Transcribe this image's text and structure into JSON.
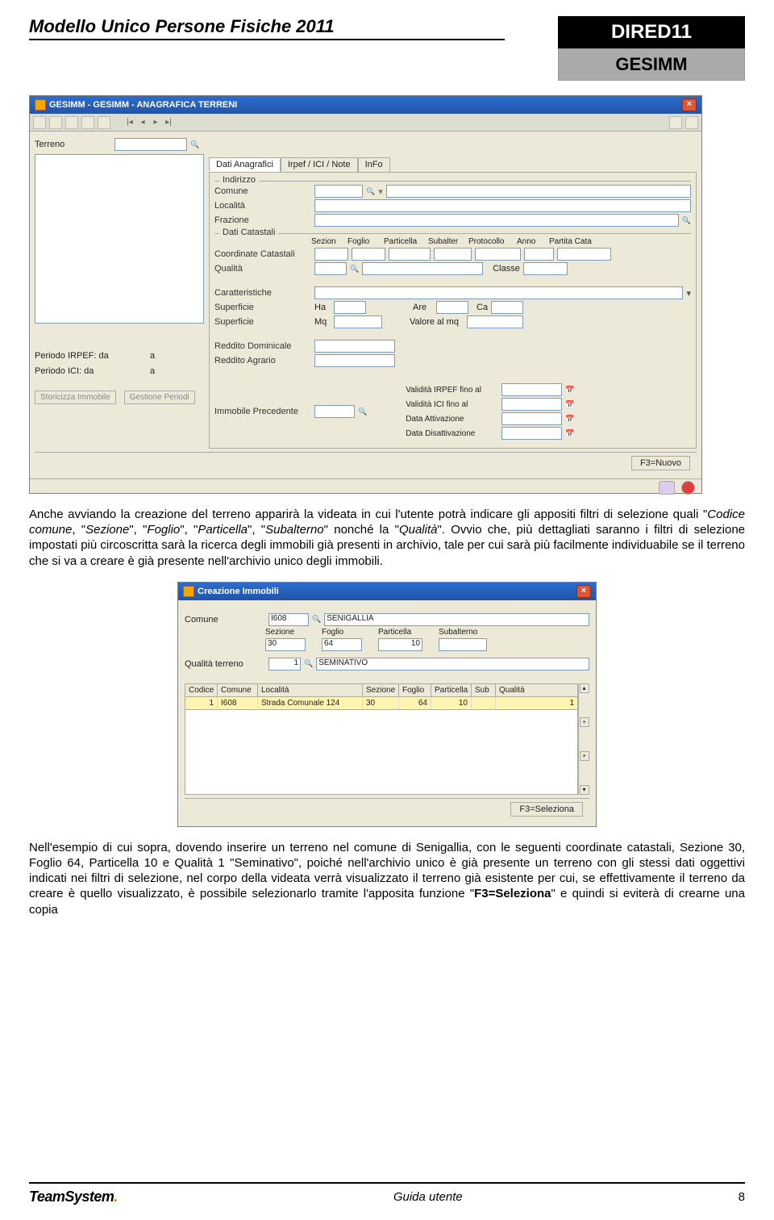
{
  "header": {
    "title": "Modello Unico Persone Fisiche 2011",
    "codebox": "DIRED11",
    "namebox": "GESIMM"
  },
  "win1": {
    "title": "GESIMM - GESIMM - ANAGRAFICA TERRENI",
    "terreno_label": "Terreno",
    "tabs": {
      "t1": "Dati Anagrafici",
      "t2": "Irpef / ICI / Note",
      "t3": "InFo"
    },
    "group1_label": "Indirizzo",
    "comune_label": "Comune",
    "localita_label": "Località",
    "frazione_label": "Frazione",
    "group2_label": "Dati Catastali",
    "cc_label": "Coordinate Catastali",
    "qualita_label": "Qualità",
    "classe_label": "Classe",
    "cols": {
      "sezion": "Sezion",
      "foglio": "Foglio",
      "particella": "Particella",
      "subalter": "Subalter",
      "protocollo": "Protocollo",
      "anno": "Anno",
      "partita": "Partita Cata"
    },
    "carat_label": "Caratteristiche",
    "sup1_label": "Superficie",
    "ha": "Ha",
    "are": "Are",
    "ca": "Ca",
    "sup2_label": "Superficie",
    "mq": "Mq",
    "valmq": "Valore al mq",
    "rd_label": "Reddito Dominicale",
    "ra_label": "Reddito Agrario",
    "pirpef": "Periodo IRPEF: da",
    "pici": "Periodo ICI: da",
    "a": "a",
    "stor": "Storicizza Immobile",
    "gest": "Gestione Periodi",
    "immprec": "Immobile Precedente",
    "valirpef": "Validità IRPEF fino al",
    "valici": "Validità ICI fino al",
    "dattiv": "Data Attivazione",
    "ddisatt": "Data Disattivazione",
    "f3": "F3=Nuovo"
  },
  "para1": {
    "p": "Anche avviando la creazione del terreno apparirà la videata in cui l'utente potrà indicare gli appositi filtri di selezione quali ",
    "i1": "Codice comune",
    "c1": ", \"",
    "i2": "Sezione",
    "c2": "\", \"",
    "i3": "Foglio",
    "c3": "\", \"",
    "i4": "Particella",
    "c4": "\", \"",
    "i5": "Subalterno",
    "c5": "\" nonché la \"",
    "i6": "Qualità",
    "c6": "\". Ovvio che, più dettagliati saranno i filtri di selezione impostati più circoscritta sarà la ricerca degli immobili già presenti in archivio, tale per cui sarà più facilmente individuabile se il terreno che si va a creare è già presente nell'archivio unico degli immobili."
  },
  "win2": {
    "title": "Creazione Immobili",
    "comune_label": "Comune",
    "comune_code": "I608",
    "comune_name": "SENIGALLIA",
    "sez_label": "Sezione",
    "fog_label": "Foglio",
    "part_label": "Particella",
    "sub_label": "Subalterno",
    "sez_v": "30",
    "fog_v": "64",
    "part_v": "10",
    "qt_label": "Qualità terreno",
    "qt_code": "1",
    "qt_name": "SEMINATIVO",
    "hdr": {
      "codice": "Codice",
      "comune": "Comune",
      "localita": "Località",
      "sezione": "Sezione",
      "foglio": "Foglio",
      "particella": "Particella",
      "sub": "Sub",
      "qualita": "Qualità"
    },
    "row": {
      "codice": "1",
      "comune": "I608",
      "localita": "Strada Comunale 124",
      "sezione": "30",
      "foglio": "64",
      "particella": "10",
      "sub": "",
      "qualita": "1"
    },
    "f3": "F3=Seleziona"
  },
  "para2": {
    "p": "Nell'esempio di cui sopra, dovendo inserire un terreno nel comune di Senigallia, con le seguenti coordinate catastali, Sezione 30, Foglio 64, Particella 10 e Qualità 1 \"Seminativo\", poiché nell'archivio unico è già presente un terreno con gli stessi dati oggettivi indicati nei filtri di selezione, nel corpo della videata verrà visualizzato il terreno già esistente per cui, se effettivamente il terreno da creare è quello visualizzato, è possibile selezionarlo tramite l'apposita funzione \"",
    "b": "F3=Seleziona",
    "c": "\" e quindi si eviterà di crearne una copia"
  },
  "footer": {
    "logo": "TeamSystem",
    "guide": "Guida utente",
    "page": "8"
  }
}
